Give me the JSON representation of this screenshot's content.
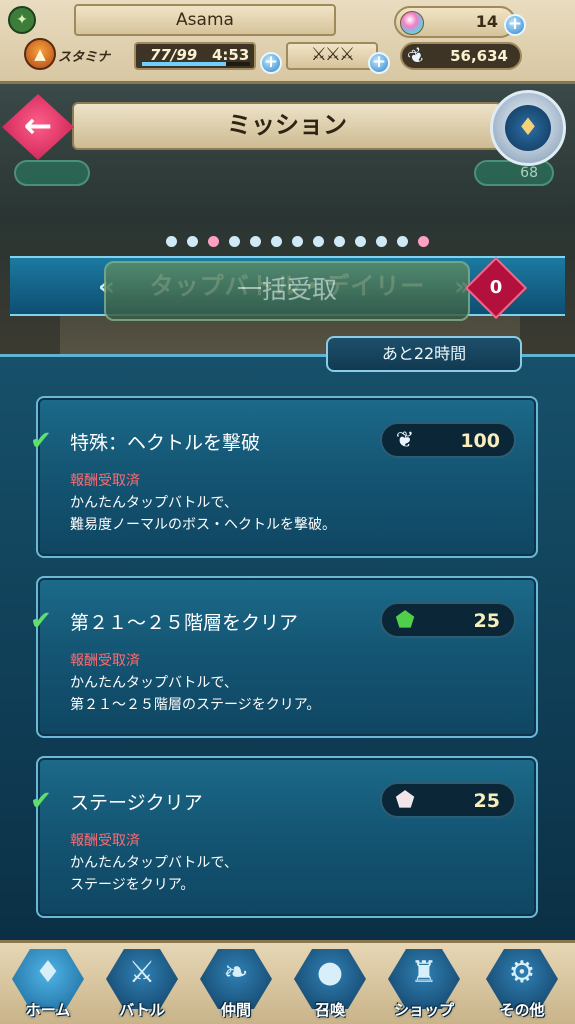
{
  "status_bar": {
    "player_name": "Asama",
    "orbs": "14",
    "stamina_label": "スタミナ",
    "stamina": "77/99",
    "stamina_fraction": 0.78,
    "timer": "4:53",
    "dueling_crests": "⚔⚔⚔",
    "feathers": "56,634",
    "level_badge_icon": "experience-icon",
    "stamina_icon": "flame-icon"
  },
  "header": {
    "title": "ミッション",
    "back_icon": "back-arrow-icon",
    "crest_icon": "crest-icon",
    "left_chip": "",
    "right_chip": "68",
    "category": "タップバトル・デイリー",
    "page_dots": [
      "#cfeaf6",
      "#cfeaf6",
      "#ff9fc4",
      "#cfeaf6",
      "#cfeaf6",
      "#cfeaf6",
      "#cfeaf6",
      "#cfeaf6",
      "#cfeaf6",
      "#cfeaf6",
      "#cfeaf6",
      "#cfeaf6",
      "#ff9fc4"
    ],
    "claim_all_label": "一括受取",
    "claim_count": "0"
  },
  "time_remaining": "あと22時間",
  "missions": [
    {
      "title": "特殊：ヘクトルを撃破",
      "reward_icon": "feather-icon",
      "reward_color": "#e8f4ff",
      "reward": "100",
      "status": "報酬受取済",
      "desc_line1": "かんたんタップバトルで、",
      "desc_line2": "難易度ノーマルのボス・ヘクトルを撃破。"
    },
    {
      "title": "第２１～２５階層をクリア",
      "reward_icon": "green-badge-icon",
      "reward_color": "#4fcf4a",
      "reward": "25",
      "status": "報酬受取済",
      "desc_line1": "かんたんタップバトルで、",
      "desc_line2": "第２１～２５階層のステージをクリア。"
    },
    {
      "title": "ステージクリア",
      "reward_icon": "white-badge-icon",
      "reward_color": "#f2e6ea",
      "reward": "25",
      "status": "報酬受取済",
      "desc_line1": "かんたんタップバトルで、",
      "desc_line2": "ステージをクリア。"
    }
  ],
  "bottom_nav": [
    {
      "label": "ホーム",
      "icon": "home-crest-icon",
      "active": true
    },
    {
      "label": "バトル",
      "icon": "swords-icon",
      "active": false
    },
    {
      "label": "仲間",
      "icon": "wing-icon",
      "active": false
    },
    {
      "label": "召喚",
      "icon": "orb-icon",
      "active": false
    },
    {
      "label": "ショップ",
      "icon": "castle-icon",
      "active": false
    },
    {
      "label": "その他",
      "icon": "gear-icon",
      "active": false
    }
  ]
}
